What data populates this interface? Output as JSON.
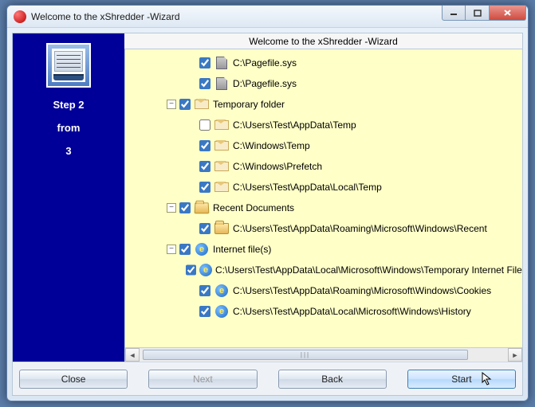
{
  "window": {
    "title": "Welcome to the xShredder -Wizard"
  },
  "sidebar": {
    "step_label": "Step  2",
    "from_label": "from",
    "total": "3"
  },
  "panel": {
    "title": "Welcome to the xShredder -Wizard"
  },
  "tree": [
    {
      "indent": 3,
      "expander": null,
      "checked": true,
      "icon": "page",
      "label": "C:\\Pagefile.sys"
    },
    {
      "indent": 3,
      "expander": null,
      "checked": true,
      "icon": "page",
      "label": "D:\\Pagefile.sys"
    },
    {
      "indent": 2,
      "expander": "-",
      "checked": true,
      "icon": "env",
      "label": "Temporary folder"
    },
    {
      "indent": 3,
      "expander": null,
      "checked": false,
      "icon": "env",
      "label": "C:\\Users\\Test\\AppData\\Temp"
    },
    {
      "indent": 3,
      "expander": null,
      "checked": true,
      "icon": "env",
      "label": "C:\\Windows\\Temp"
    },
    {
      "indent": 3,
      "expander": null,
      "checked": true,
      "icon": "env",
      "label": "C:\\Windows\\Prefetch"
    },
    {
      "indent": 3,
      "expander": null,
      "checked": true,
      "icon": "env",
      "label": "C:\\Users\\Test\\AppData\\Local\\Temp"
    },
    {
      "indent": 2,
      "expander": "-",
      "checked": true,
      "icon": "folder-open",
      "label": "Recent Documents"
    },
    {
      "indent": 3,
      "expander": null,
      "checked": true,
      "icon": "folder",
      "label": "C:\\Users\\Test\\AppData\\Roaming\\Microsoft\\Windows\\Recent"
    },
    {
      "indent": 2,
      "expander": "-",
      "checked": true,
      "icon": "ie",
      "label": "Internet file(s)"
    },
    {
      "indent": 3,
      "expander": null,
      "checked": true,
      "icon": "ie",
      "label": "C:\\Users\\Test\\AppData\\Local\\Microsoft\\Windows\\Temporary Internet Files"
    },
    {
      "indent": 3,
      "expander": null,
      "checked": true,
      "icon": "ie",
      "label": "C:\\Users\\Test\\AppData\\Roaming\\Microsoft\\Windows\\Cookies"
    },
    {
      "indent": 3,
      "expander": null,
      "checked": true,
      "icon": "ie",
      "label": "C:\\Users\\Test\\AppData\\Local\\Microsoft\\Windows\\History"
    }
  ],
  "buttons": {
    "close": "Close",
    "next": "Next",
    "back": "Back",
    "start": "Start"
  }
}
